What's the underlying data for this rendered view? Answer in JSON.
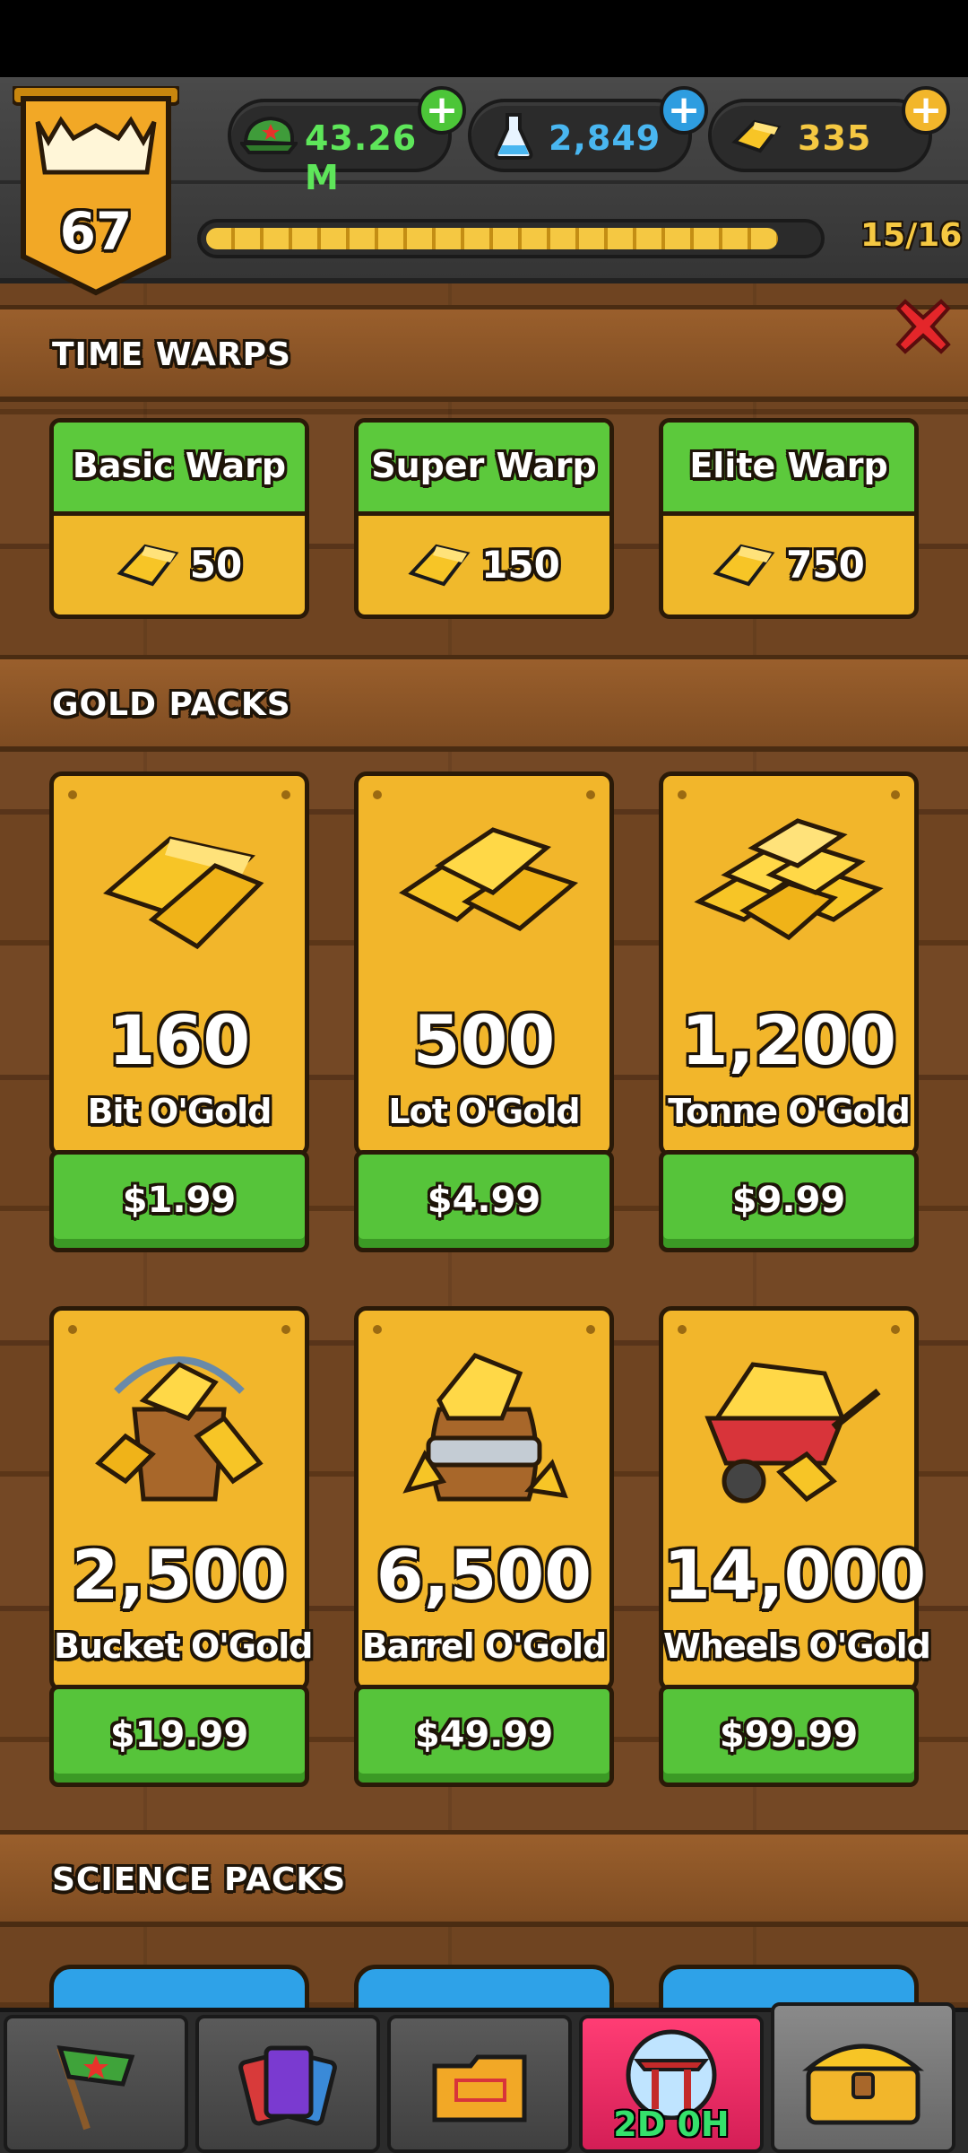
{
  "header": {
    "level": "67",
    "currencies": {
      "cash": "43.26 M",
      "science": "2,849",
      "gold": "335"
    },
    "xp": {
      "text": "15/16",
      "progress": 0.9375
    }
  },
  "sections": {
    "time_warps": "TIME WARPS",
    "gold_packs": "GOLD PACKS",
    "science_packs": "SCIENCE PACKS"
  },
  "time_warps": [
    {
      "name": "Basic Warp",
      "price": "50"
    },
    {
      "name": "Super Warp",
      "price": "150"
    },
    {
      "name": "Elite Warp",
      "price": "750"
    }
  ],
  "gold_packs": [
    {
      "amount": "160",
      "name": "Bit O'Gold",
      "price": "$1.99",
      "icon": "gold-bars-small-icon"
    },
    {
      "amount": "500",
      "name": "Lot O'Gold",
      "price": "$4.99",
      "icon": "gold-bars-stack-icon"
    },
    {
      "amount": "1,200",
      "name": "Tonne O'Gold",
      "price": "$9.99",
      "icon": "gold-bars-pile-icon"
    },
    {
      "amount": "2,500",
      "name": "Bucket O'Gold",
      "price": "$19.99",
      "icon": "gold-bucket-icon"
    },
    {
      "amount": "6,500",
      "name": "Barrel O'Gold",
      "price": "$49.99",
      "icon": "gold-barrel-icon"
    },
    {
      "amount": "14,000",
      "name": "Wheels O'Gold",
      "price": "$99.99",
      "icon": "gold-wheelbarrow-icon"
    }
  ],
  "bottom_nav": {
    "event_timer": "2D 0H",
    "tabs": [
      "flag-icon",
      "cards-icon",
      "folder-icon",
      "shrine-icon",
      "treasure-chest-icon"
    ]
  },
  "colors": {
    "gold": "#f2b62b",
    "green_button": "#56c43a",
    "wood": "#6f4421",
    "event_pink": "#e8245f"
  }
}
